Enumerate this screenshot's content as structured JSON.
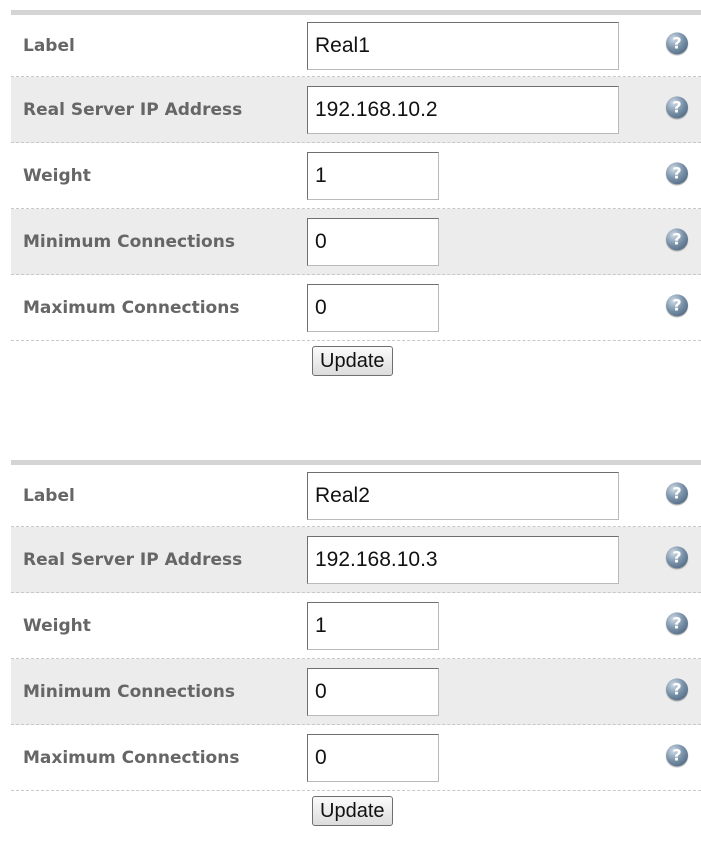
{
  "forms": [
    {
      "fields": [
        {
          "label": "Label",
          "value": "Real1"
        },
        {
          "label": "Real Server IP Address",
          "value": "192.168.10.2"
        },
        {
          "label": "Weight",
          "value": "1"
        },
        {
          "label": "Minimum Connections",
          "value": "0"
        },
        {
          "label": "Maximum Connections",
          "value": "0"
        }
      ],
      "update_label": "Update"
    },
    {
      "fields": [
        {
          "label": "Label",
          "value": "Real2"
        },
        {
          "label": "Real Server IP Address",
          "value": "192.168.10.3"
        },
        {
          "label": "Weight",
          "value": "1"
        },
        {
          "label": "Minimum Connections",
          "value": "0"
        },
        {
          "label": "Maximum Connections",
          "value": "0"
        }
      ],
      "update_label": "Update"
    }
  ],
  "help_icon": {
    "glyph": "?",
    "icon": "help-icon"
  },
  "colors": {
    "label_text": "#666666",
    "shaded_row": "#ececec",
    "top_bar": "#d4d4d4"
  }
}
